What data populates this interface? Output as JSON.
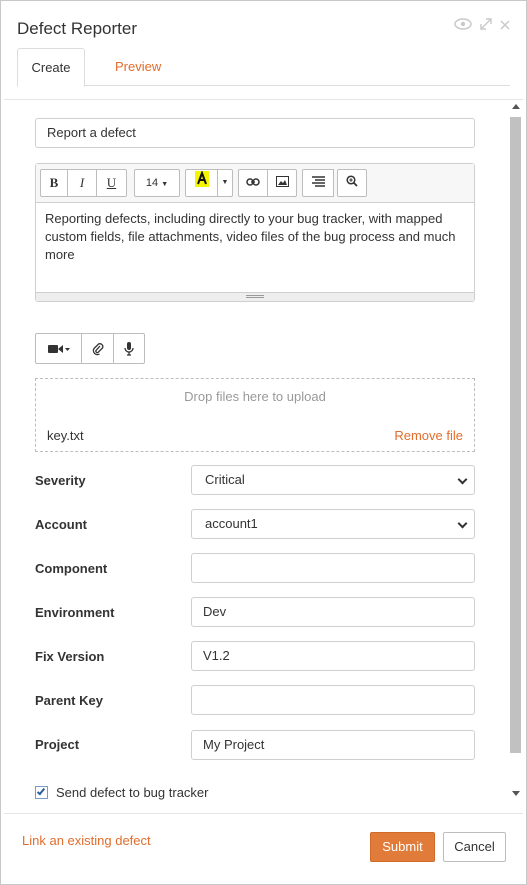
{
  "dialog": {
    "title": "Defect Reporter"
  },
  "tabs": [
    {
      "label": "Create"
    },
    {
      "label": "Preview"
    }
  ],
  "form": {
    "subject": "Report a defect",
    "editor": {
      "font_size": "14",
      "body": "Reporting defects, including directly to your bug tracker, with mapped custom fields, file attachments, video files of the bug process and much more"
    },
    "dropzone": {
      "hint": "Drop files here to upload",
      "file_name": "key.txt",
      "remove_label": "Remove file"
    },
    "fields": {
      "severity": {
        "label": "Severity",
        "value": "Critical"
      },
      "account": {
        "label": "Account",
        "value": "account1"
      },
      "component": {
        "label": "Component",
        "value": ""
      },
      "environment": {
        "label": "Environment",
        "value": "Dev"
      },
      "fix_version": {
        "label": "Fix Version",
        "value": "V1.2"
      },
      "parent_key": {
        "label": "Parent Key",
        "value": ""
      },
      "project": {
        "label": "Project",
        "value": "My Project"
      }
    },
    "send_to_tracker": {
      "label": "Send defect to bug tracker",
      "checked": true
    }
  },
  "footer": {
    "link_existing": "Link an existing defect",
    "submit": "Submit",
    "cancel": "Cancel"
  },
  "colors": {
    "accent": "#e07b39",
    "link": "#e06d2b"
  }
}
